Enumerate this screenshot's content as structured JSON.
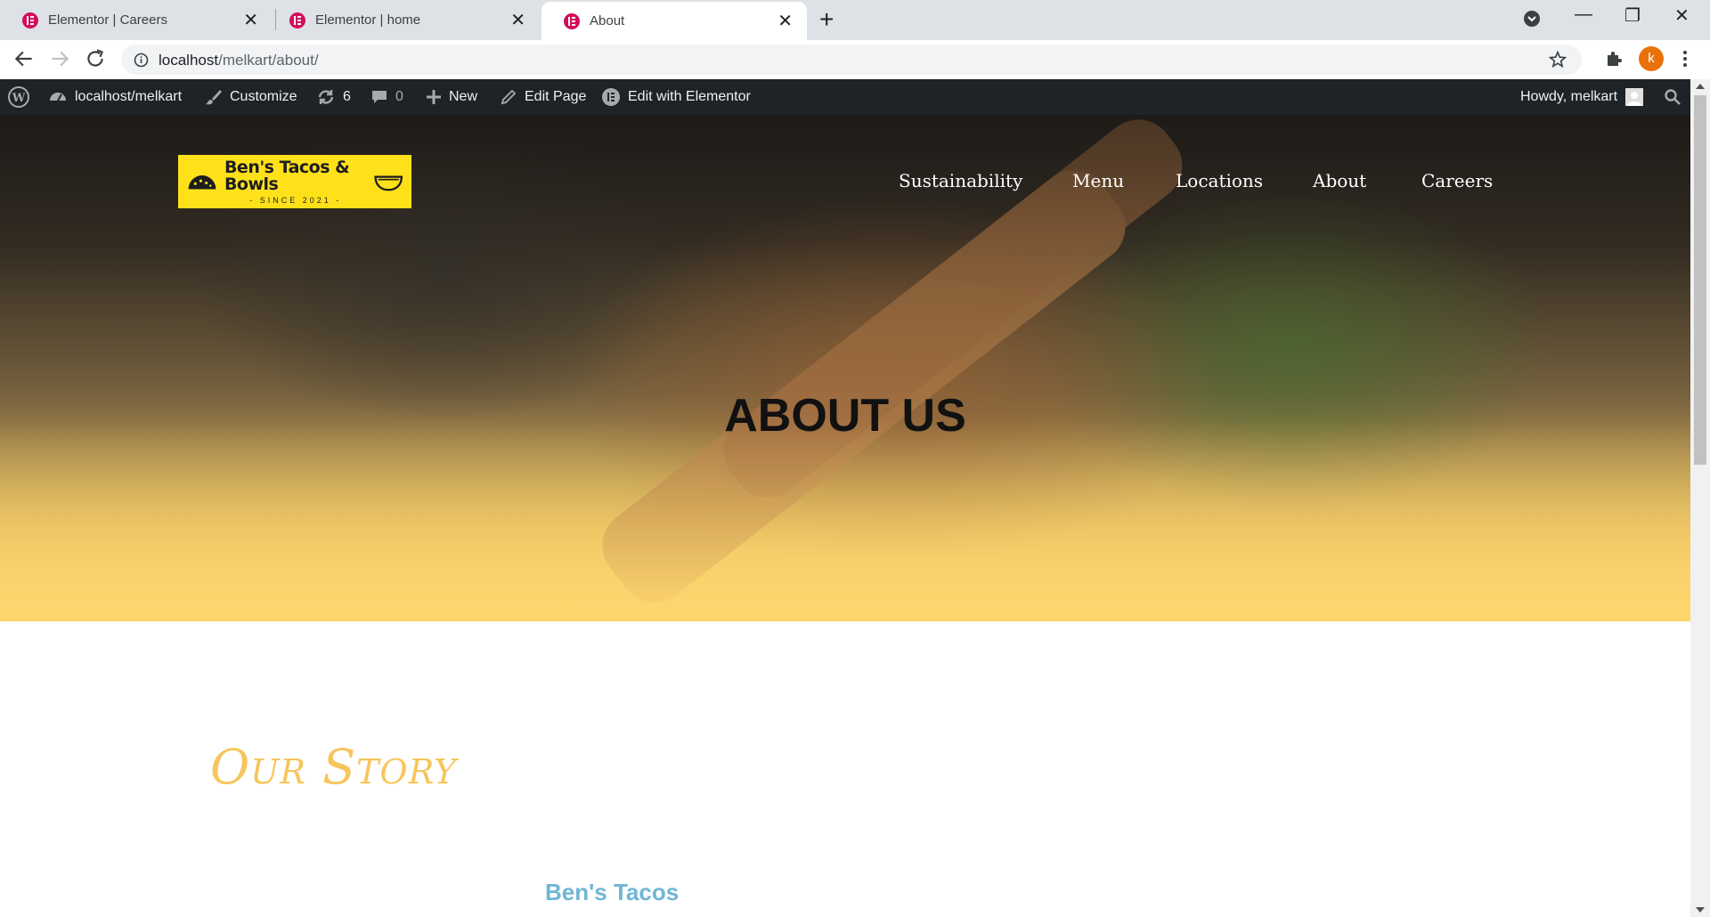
{
  "browser": {
    "tabs": [
      {
        "title": "Elementor | Careers",
        "active": false
      },
      {
        "title": "Elementor | home",
        "active": false
      },
      {
        "title": "About",
        "active": true
      }
    ],
    "url_host": "localhost",
    "url_path": "/melkart/about/"
  },
  "adminbar": {
    "site": "localhost/melkart",
    "customize": "Customize",
    "updates_count": "6",
    "comments_count": "0",
    "new": "New",
    "edit_page": "Edit Page",
    "edit_elementor": "Edit with Elementor",
    "howdy": "Howdy, melkart"
  },
  "site": {
    "logo_text": "Ben's Tacos & Bowls",
    "logo_sub": "- SINCE 2021 -",
    "nav": [
      "Sustainability",
      "Menu",
      "Locations",
      "About",
      "Careers"
    ]
  },
  "hero": {
    "title": "ABOUT US"
  },
  "content": {
    "section_title": "Our Story",
    "subheading": "Ben's Tacos"
  },
  "colors": {
    "accent_yellow": "#fdd46b",
    "story_color": "#f7c55c",
    "subhead_color": "#6fb6d6",
    "adminbar_bg": "#1d2327"
  },
  "profile": {
    "initial": "k"
  }
}
